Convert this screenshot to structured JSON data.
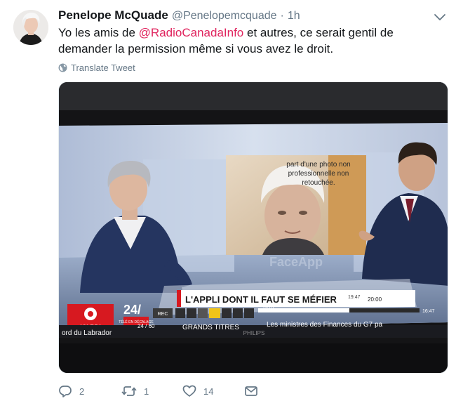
{
  "tweet": {
    "author_name": "Penelope McQuade",
    "handle": "@Penelopemcquade",
    "separator": "·",
    "time": "1h",
    "text_before": "Yo les amis de ",
    "mention": "@RadioCanadaInfo",
    "text_after": " et autres, ce serait gentil de demander la permission même si vous avez le droit.",
    "translate_label": "Translate Tweet"
  },
  "media": {
    "overlay_caption": "part d'une photo non professionnelle non retouchée.",
    "caption_line1": "part d'une photo non",
    "caption_line2": "professionnelle non",
    "caption_line3": "retouchée.",
    "lower_third_title": "L'APPLI DONT IL FAUT SE MÉFIER",
    "clock_top": "19:47",
    "time_start": "19:01",
    "time_end": "20:00",
    "time_right": "16:47",
    "channel_brand": "ICI RDI",
    "channel_number": "24/",
    "channel_sub": "TÉLÉ EN DÉCALAGE",
    "rec_label": "REC",
    "page_indicator": "24 / 60",
    "ticker_left": "ord du Labrador",
    "ticker_section": "GRANDS TITRES",
    "ticker_text": "Les ministres des Finances du G7 pa",
    "tv_brand": "PHILIPS",
    "screen_watermark": "FaceApp"
  },
  "actions": {
    "reply_count": "2",
    "retweet_count": "1",
    "like_count": "14"
  },
  "colors": {
    "mention": "#e0245e",
    "muted": "#657786",
    "cbc_red": "#d71920"
  }
}
